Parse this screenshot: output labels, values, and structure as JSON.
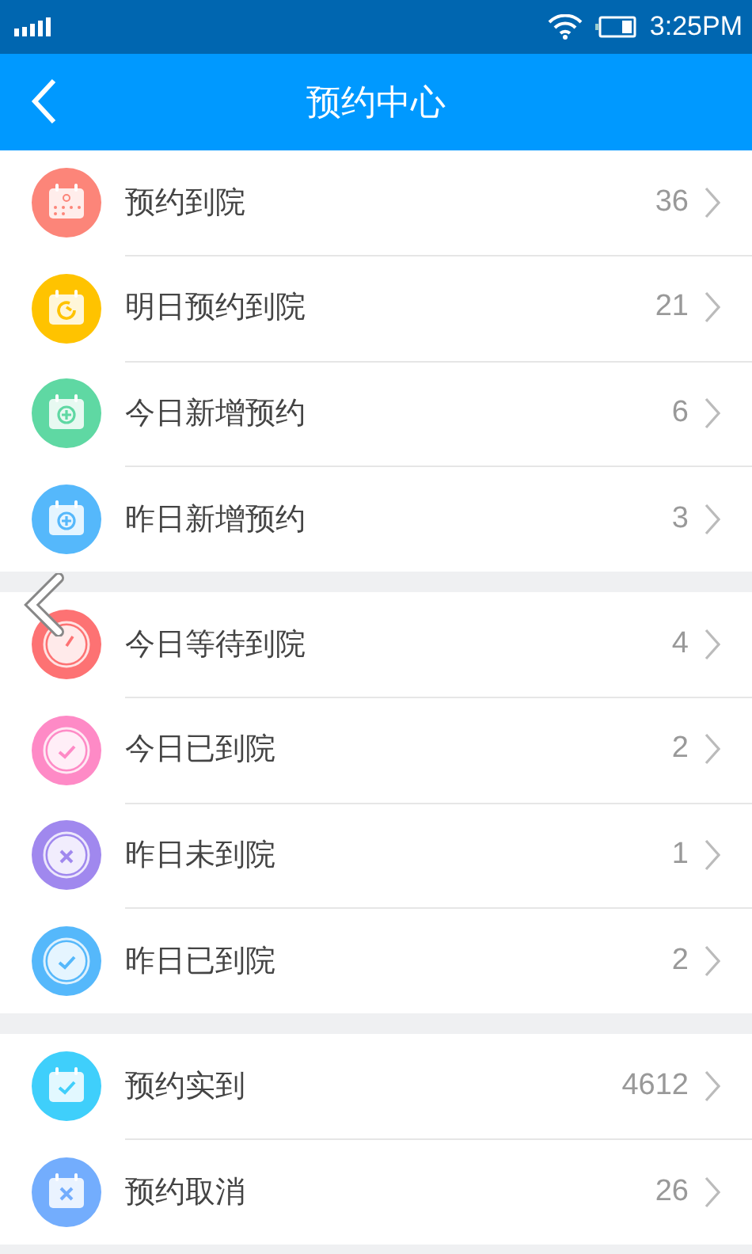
{
  "status_bar": {
    "time": "3:25PM"
  },
  "nav_bar": {
    "title": "预约中心"
  },
  "groups": [
    {
      "items": [
        {
          "label": "预约到院",
          "count": "36",
          "color": "#fc8579",
          "kind": "calendardots"
        },
        {
          "label": "明日预约到院",
          "count": "21",
          "color": "#ffc300",
          "kind": "calendarrefresh"
        },
        {
          "label": "今日新增预约",
          "count": "6",
          "color": "#5fd8a3",
          "kind": "calendarplus"
        },
        {
          "label": "昨日新增预约",
          "count": "3",
          "color": "#55b8fb",
          "kind": "calendarplus"
        }
      ]
    },
    {
      "items": [
        {
          "label": "今日等待到院",
          "count": "4",
          "color": "#fd7273",
          "kind": "clock"
        },
        {
          "label": "今日已到院",
          "count": "2",
          "color": "#fe8ac6",
          "kind": "circlecheck"
        },
        {
          "label": "昨日未到院",
          "count": "1",
          "color": "#a088ee",
          "kind": "circlex"
        },
        {
          "label": "昨日已到院",
          "count": "2",
          "color": "#55b8fb",
          "kind": "circlecheck"
        }
      ]
    },
    {
      "items": [
        {
          "label": "预约实到",
          "count": "4612",
          "color": "#3fcffb",
          "kind": "calendarcheck"
        },
        {
          "label": "预约取消",
          "count": "26",
          "color": "#73adfd",
          "kind": "calendarx"
        }
      ]
    }
  ]
}
